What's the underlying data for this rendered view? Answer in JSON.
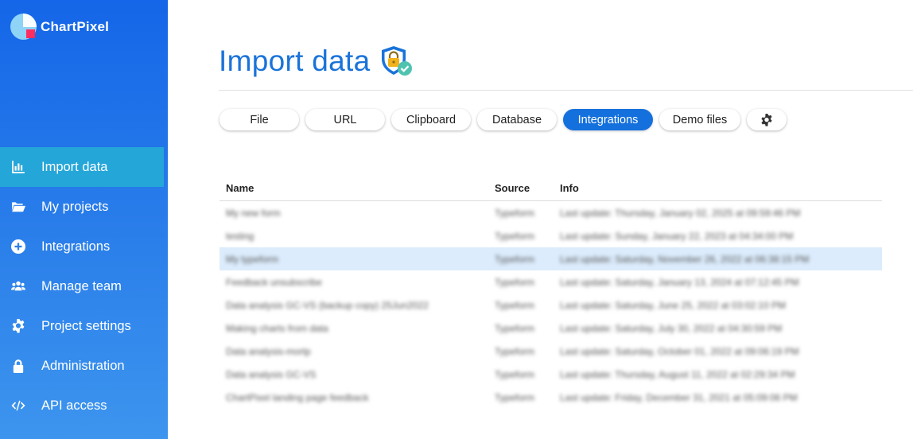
{
  "app": {
    "logo_text": "ChartPixel",
    "logo_colors": {
      "pie": "#8fd3f7",
      "square": "#ff2d5f"
    }
  },
  "sidebar": {
    "items": [
      {
        "label": "Import data",
        "icon": "chart-bar-icon",
        "active": true
      },
      {
        "label": "My projects",
        "icon": "folder-open-icon"
      },
      {
        "label": "Integrations",
        "icon": "plus-circle-icon"
      },
      {
        "label": "Manage team",
        "icon": "users-icon"
      },
      {
        "label": "Project settings",
        "icon": "gear-icon"
      },
      {
        "label": "Administration",
        "icon": "lock-icon"
      },
      {
        "label": "API access",
        "icon": "code-icon"
      }
    ]
  },
  "main": {
    "title": "Import data",
    "title_badge_icon": "secure-shield-lock-icon",
    "tabs": [
      {
        "label": "File"
      },
      {
        "label": "URL"
      },
      {
        "label": "Clipboard"
      },
      {
        "label": "Database"
      },
      {
        "label": "Integrations",
        "active": true
      },
      {
        "label": "Demo files"
      },
      {
        "label": "",
        "icon": "gear-icon"
      }
    ],
    "table": {
      "headers": {
        "name": "Name",
        "source": "Source",
        "info": "Info"
      },
      "rows": [
        {
          "name": "My new form",
          "source": "Typeform",
          "info": "Last update: Thursday, January 02, 2025 at 09:59:46 PM"
        },
        {
          "name": "testing",
          "source": "Typeform",
          "info": "Last update: Sunday, January 22, 2023 at 04:34:00 PM"
        },
        {
          "name": "My typeform",
          "source": "Typeform",
          "info": "Last update: Saturday, November 26, 2022 at 06:38:15 PM",
          "selected": true
        },
        {
          "name": "Feedback unsubscribe",
          "source": "Typeform",
          "info": "Last update: Saturday, January 13, 2024 at 07:12:45 PM"
        },
        {
          "name": "Data analysis GC-VS (backup copy) 25Jun2022",
          "source": "Typeform",
          "info": "Last update: Saturday, June 25, 2022 at 03:02:10 PM"
        },
        {
          "name": "Making charts from data",
          "source": "Typeform",
          "info": "Last update: Saturday, July 30, 2022 at 04:30:59 PM"
        },
        {
          "name": "Data analysis-mortp",
          "source": "Typeform",
          "info": "Last update: Saturday, October 01, 2022 at 09:06:19 PM"
        },
        {
          "name": "Data analysis GC-VS",
          "source": "Typeform",
          "info": "Last update: Thursday, August 11, 2022 at 02:29:34 PM"
        },
        {
          "name": "ChartPixel landing page feedback",
          "source": "Typeform",
          "info": "Last update: Friday, December 31, 2021 at 05:09:06 PM"
        }
      ]
    }
  },
  "colors": {
    "accent": "#1470dc",
    "active_nav": "#24a6d9",
    "title": "#1a73d9",
    "selected_row": "#dcecfc"
  }
}
